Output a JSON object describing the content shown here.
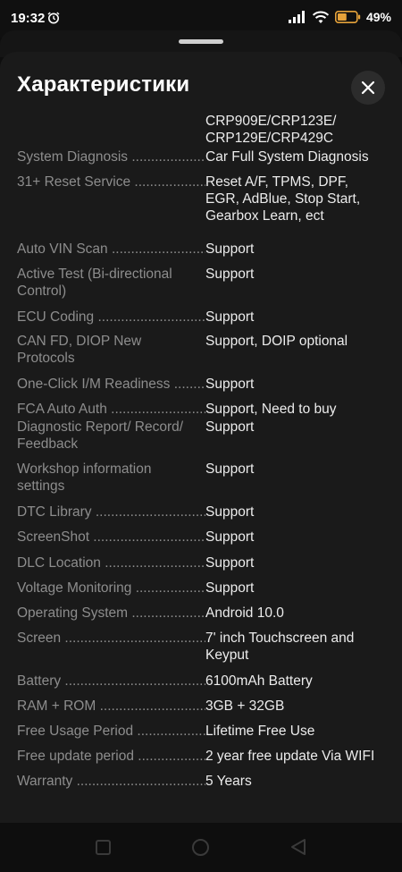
{
  "status": {
    "time": "19:32",
    "battery_percent": "49%",
    "battery_level": 0.49,
    "icons": [
      "alarm-icon",
      "signal-icon",
      "wifi-icon",
      "battery-icon"
    ]
  },
  "sheet": {
    "title": "Характеристики",
    "close_icon": "close-icon",
    "top_continuation": [
      "CRP909E/CRP123E/",
      "CRP129E/CRP429C"
    ]
  },
  "specs": [
    {
      "label": "System Diagnosis",
      "value": [
        "Car Full System Diagnosis"
      ]
    },
    {
      "label": "31+ Reset Service",
      "value": [
        "Reset A/F, TPMS, DPF,",
        "EGR,  AdBlue, Stop Start,",
        "Gearbox Learn, ect"
      ]
    },
    {
      "label": "Auto VIN Scan",
      "value": [
        "Support"
      ]
    },
    {
      "label": "Active Test (Bi-directional Control)",
      "value": [
        "Support"
      ]
    },
    {
      "label": "ECU Coding",
      "value": [
        "Support"
      ]
    },
    {
      "label": "CAN FD, DIOP New Protocols",
      "value": [
        "Support,  DOIP optional"
      ]
    },
    {
      "label": "One-Click I/M Readiness",
      "value": [
        "Support"
      ]
    },
    {
      "label": "FCA Auto Auth",
      "value": [
        "Support, Need to buy"
      ]
    },
    {
      "label": "Diagnostic Report/ Record/ Feedback",
      "value": [
        "Support"
      ]
    },
    {
      "label": "Workshop information settings",
      "value": [
        "Support"
      ]
    },
    {
      "label": "DTC Library",
      "value": [
        "Support"
      ]
    },
    {
      "label": "ScreenShot",
      "value": [
        "Support"
      ]
    },
    {
      "label": "DLC Location",
      "value": [
        "Support"
      ]
    },
    {
      "label": "Voltage Monitoring",
      "value": [
        "Support"
      ]
    },
    {
      "label": "Operating System",
      "value": [
        "Android 10.0"
      ]
    },
    {
      "label": "Screen",
      "value": [
        "7' inch Touchscreen and",
        "Keyput"
      ]
    },
    {
      "label": "Battery",
      "value": [
        "6100mAh Battery"
      ]
    },
    {
      "label": "RAM + ROM",
      "value": [
        "3GB + 32GB"
      ]
    },
    {
      "label": "Free Usage Period",
      "value": [
        "Lifetime Free Use"
      ]
    },
    {
      "label": "Free update period",
      "value": [
        "2 year free update Via WIFI"
      ]
    },
    {
      "label": "Warranty",
      "value": [
        "5 Years"
      ]
    }
  ],
  "nav": {
    "icons": [
      "recent-apps-icon",
      "home-icon",
      "back-icon"
    ]
  }
}
